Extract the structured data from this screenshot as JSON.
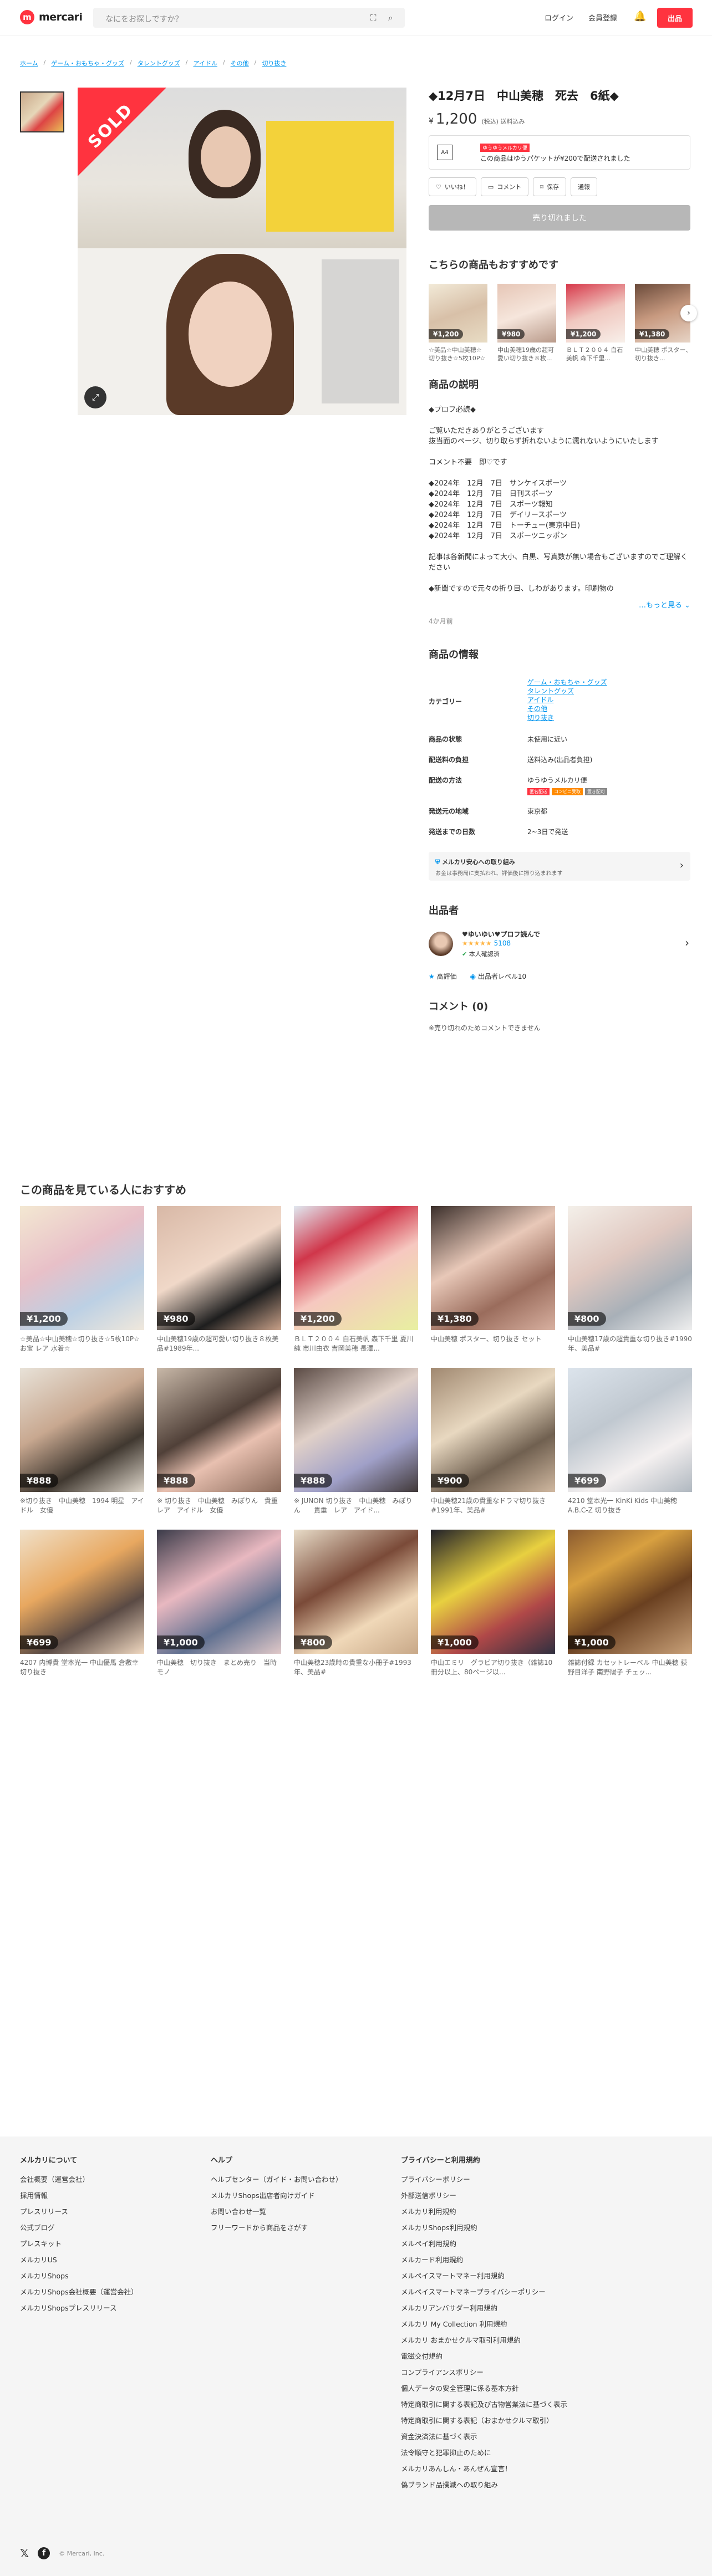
{
  "header": {
    "logo": "mercari",
    "search_placeholder": "なにをお探しですか？",
    "login": "ログイン",
    "signup": "会員登録",
    "sell": "出品"
  },
  "breadcrumb": [
    "ホーム",
    "ゲーム・おもちゃ・グッズ",
    "タレントグッズ",
    "アイドル",
    "その他",
    "切り抜き"
  ],
  "product": {
    "sold_badge": "SOLD",
    "title": "◆12月7日　中山美穂　死去　6紙◆",
    "price_yen": "¥",
    "price": "1,200",
    "price_note": "(税込) 送料込み",
    "shipping_badge": "ゆうゆうメルカリ便",
    "shipping_text": "この商品はゆうパケットが¥200で配送されました",
    "shipping_icon_label": "A4",
    "actions": {
      "like": "いいね！",
      "comment": "コメント",
      "save": "保存",
      "report": "通報"
    },
    "sold_button": "売り切れました"
  },
  "recs": {
    "title": "こちらの商品もおすすめです",
    "items": [
      {
        "price": "¥1,200",
        "name": "☆美品☆中山美穂☆切り抜き☆5枚10P☆お宝 レア 水着☆"
      },
      {
        "price": "¥980",
        "name": "中山美穂19歳の超可愛い切り抜き８枚..."
      },
      {
        "price": "¥1,200",
        "name": "ＢＬＴ２００４ 白石美帆 森下千里..."
      },
      {
        "price": "¥1,380",
        "name": "中山美穂 ポスター、切り抜き..."
      }
    ]
  },
  "description": {
    "title": "商品の説明",
    "text": "◆プロフ必読◆\n\nご覧いただきありがとうございます\n抜当面のページ、切り取らず折れないように濡れないようにいたします\n\nコメント不要　即♡です\n\n◆2024年　12月　7日　サンケイスポーツ\n◆2024年　12月　7日　日刊スポーツ\n◆2024年　12月　7日　スポーツ報知\n◆2024年　12月　7日　デイリースポーツ\n◆2024年　12月　7日　トーチュー(東京中日)\n◆2024年　12月　7日　スポーツニッポン\n\n記事は各新聞によって大小、白黒、写真数が無い場合もございますのでご理解ください\n\n◆新聞ですので元々の折り目、しわがあります。印刷物の",
    "more": "もっと見る",
    "time": "4か月前"
  },
  "info": {
    "title": "商品の情報",
    "category_label": "カテゴリー",
    "categories": [
      "ゲーム・おもちゃ・グッズ",
      "タレントグッズ",
      "アイドル",
      "その他",
      "切り抜き"
    ],
    "rows": [
      {
        "k": "商品の状態",
        "v": "未使用に近い"
      },
      {
        "k": "配送料の負担",
        "v": "送料込み(出品者負担)"
      },
      {
        "k": "配送の方法",
        "v": "ゆうゆうメルカリ便"
      },
      {
        "k": "発送元の地域",
        "v": "東京都"
      },
      {
        "k": "発送までの日数",
        "v": "2~3日で発送"
      }
    ],
    "ship_tags": [
      "匿名配送",
      "コンビニ受取",
      "置き配可"
    ]
  },
  "safe": {
    "title": "メルカリ安心への取り組み",
    "text": "お金は事務局に支払われ、評価後に振り込まれます"
  },
  "seller": {
    "section": "出品者",
    "name": "♥ゆいゆい♥プロフ読んで",
    "rating_count": "5108",
    "verified": "本人確認済",
    "badge1": "高評価",
    "badge2": "出品者レベル10"
  },
  "comments": {
    "title": "コメント (0)",
    "note": "※売り切れのためコメントできません"
  },
  "grid": {
    "title": "この商品を見ている人におすすめ",
    "items": [
      {
        "price": "¥1,200",
        "name": "☆美品☆中山美穂☆切り抜き☆5枚10P☆お宝 レア 水着☆"
      },
      {
        "price": "¥980",
        "name": "中山美穂19歳の超可愛い切り抜き８枚美品#1989年..."
      },
      {
        "price": "¥1,200",
        "name": "ＢＬＴ２００４ 白石美帆 森下千里 夏川純 市川由衣 吉岡美穂 長澤..."
      },
      {
        "price": "¥1,380",
        "name": "中山美穂 ポスター、切り抜き セット"
      },
      {
        "price": "¥800",
        "name": "中山美穂17歳の超貴重な切り抜き#1990年、美品#"
      },
      {
        "price": "¥888",
        "name": "※切り抜き　中山美穂　1994 明星　アイドル　女優"
      },
      {
        "price": "¥888",
        "name": "※ 切り抜き　中山美穂　みぽりん　貴重　レア　アイドル　女優"
      },
      {
        "price": "¥888",
        "name": "※ JUNON 切り抜き　中山美穂　みぽりん　　貴重　レア　アイド..."
      },
      {
        "price": "¥900",
        "name": "中山美穂21歳の貴重なドラマ切り抜き#1991年、美品#"
      },
      {
        "price": "¥699",
        "name": "4210 堂本光一 KinKi Kids 中山美穂 A.B.C-Z 切り抜き"
      },
      {
        "price": "¥699",
        "name": "4207 内博貴 堂本光一 中山優馬 倉敷幸 切り抜き"
      },
      {
        "price": "¥1,000",
        "name": "中山美穂　切り抜き　まとめ売り　当時モノ"
      },
      {
        "price": "¥800",
        "name": "中山美穂23歳時の貴重な小冊子#1993年、美品#"
      },
      {
        "price": "¥1,000",
        "name": "中山エミリ　グラビア切り抜き（雑誌10冊分以上、80ページ以..."
      },
      {
        "price": "¥1,000",
        "name": "雑誌付録 カセットレーベル 中山美穂 荻野目洋子 南野陽子 チェッ..."
      }
    ]
  },
  "footer": {
    "col1": {
      "title": "メルカリについて",
      "links": [
        "会社概要（運営会社）",
        "採用情報",
        "プレスリリース",
        "公式ブログ",
        "プレスキット",
        "メルカリUS",
        "メルカリShops",
        "メルカリShops会社概要（運営会社）",
        "メルカリShopsプレスリリース"
      ]
    },
    "col2": {
      "title": "ヘルプ",
      "links": [
        "ヘルプセンター（ガイド・お問い合わせ）",
        "メルカリShops出店者向けガイド",
        "お問い合わせ一覧",
        "フリーワードから商品をさがす"
      ]
    },
    "col3": {
      "title": "プライバシーと利用規約",
      "links": [
        "プライバシーポリシー",
        "外部送信ポリシー",
        "メルカリ利用規約",
        "メルカリShops利用規約",
        "メルペイ利用規約",
        "メルカード利用規約",
        "メルペイスマートマネー利用規約",
        "メルペイスマートマネープライバシーポリシー",
        "メルカリアンバサダー利用規約",
        "メルカリ My Collection 利用規約",
        "メルカリ おまかせクルマ取引利用規約",
        "電磁交付規約",
        "コンプライアンスポリシー",
        "個人データの安全管理に係る基本方針",
        "特定商取引に関する表記及び古物営業法に基づく表示",
        "特定商取引に関する表記（おまかせクルマ取引）",
        "資金決済法に基づく表示",
        "法令順守と犯罪抑止のために",
        "メルカリあんしん・あんぜん宣言！",
        "偽ブランド品撲滅への取り組み"
      ]
    },
    "copyright": "© Mercari, Inc."
  },
  "colors": {
    "brand": "#ff333f",
    "link": "#0095ee"
  }
}
